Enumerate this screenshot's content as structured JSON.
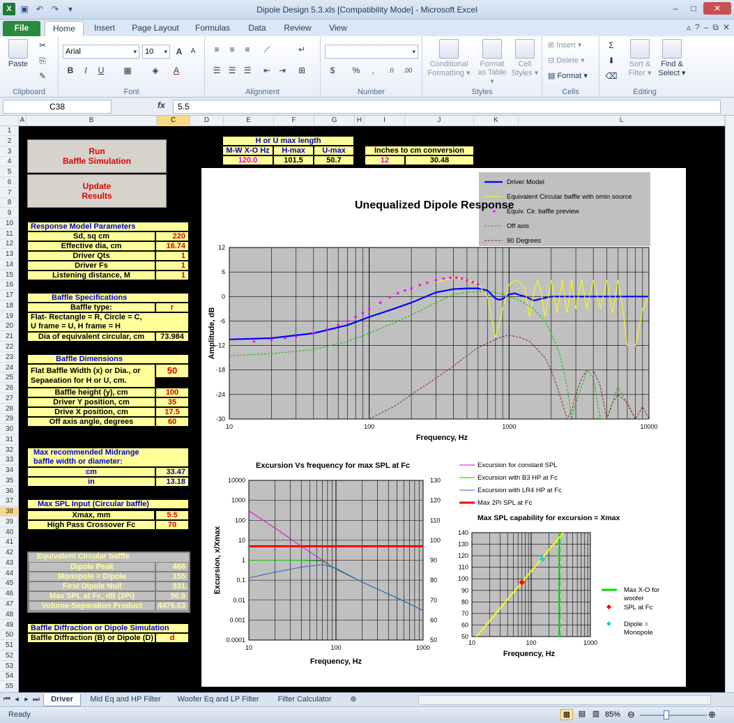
{
  "window": {
    "title": "Dipole Design 5.3.xls  [Compatibility Mode]  -  Microsoft Excel"
  },
  "ribbon_tabs": [
    "File",
    "Home",
    "Insert",
    "Page Layout",
    "Formulas",
    "Data",
    "Review",
    "View"
  ],
  "ribbon": {
    "clipboard": {
      "paste": "Paste",
      "label": "Clipboard"
    },
    "font": {
      "name": "Arial",
      "size": "10",
      "label": "Font"
    },
    "alignment": {
      "label": "Alignment"
    },
    "number": {
      "label": "Number"
    },
    "styles": {
      "conditional": "Conditional",
      "formatting": "Formatting ▾",
      "format": "Format",
      "as_table": "as Table ▾",
      "cell": "Cell",
      "cell_styles": "Styles ▾",
      "label": "Styles"
    },
    "cells": {
      "insert": "Insert ▾",
      "delete": "Delete ▾",
      "format": "Format ▾",
      "label": "Cells"
    },
    "editing": {
      "sort": "Sort &",
      "filter": "Filter ▾",
      "find": "Find &",
      "select": "Select ▾",
      "label": "Editing"
    }
  },
  "formula_bar": {
    "name_box": "C38",
    "fx": "fx",
    "value": "5.5"
  },
  "columns": [
    "A",
    "B",
    "C",
    "D",
    "E",
    "F",
    "G",
    "H",
    "I",
    "J",
    "K",
    "L"
  ],
  "rows": [
    "1",
    "2",
    "3",
    "4",
    "5",
    "6",
    "7",
    "8",
    "9",
    "10",
    "11",
    "12",
    "13",
    "14",
    "15",
    "16",
    "17",
    "18",
    "19",
    "20",
    "21",
    "22",
    "23",
    "24",
    "25",
    "26",
    "27",
    "28",
    "29",
    "30",
    "31",
    "32",
    "33",
    "34",
    "35",
    "36",
    "37",
    "38",
    "39",
    "40",
    "41",
    "42",
    "43",
    "44",
    "45",
    "46",
    "47",
    "48",
    "49",
    "50",
    "51",
    "52",
    "53",
    "54",
    "55"
  ],
  "buttons": {
    "run": [
      "Run",
      "Baffle  Simulation"
    ],
    "update": [
      "Update",
      "Results"
    ]
  },
  "hu_table": {
    "title": "H or U max length",
    "headers": [
      "M-W  X-O Hz",
      "H-max",
      "U-max"
    ],
    "values": [
      "120.0",
      "101.5",
      "50.7"
    ]
  },
  "conv_table": {
    "title": "Inches to  cm conversion",
    "values": [
      "12",
      "30.48"
    ]
  },
  "response_params": {
    "title": "Response Model Parameters",
    "rows": [
      [
        "Sd, sq cm",
        "220"
      ],
      [
        "Effective dia, cm",
        "16.74"
      ],
      [
        "Driver Qts",
        "1"
      ],
      [
        "Driver Fs",
        "1"
      ],
      [
        "Listening distance, M",
        "1"
      ]
    ]
  },
  "baffle_spec": {
    "title": "Baffle Specifications",
    "type_label": "Baffle type:",
    "type_value": "r",
    "desc1": "Flat- Rectangle = R, Circle = C,",
    "desc2": "U frame = U, H frame = H",
    "dia_label": "Dia of equivalent circular, cm",
    "dia_value": "73.984"
  },
  "baffle_dims": {
    "title": "Baffle Dimensions",
    "width_label1": "Flat Baffle Width (x) or Dia., or",
    "width_label2": "Sepaeation for H or U, cm.",
    "width_value": "50",
    "rows": [
      [
        "Baffle height (y), cm",
        "100"
      ],
      [
        "Driver Y position, cm",
        "35"
      ],
      [
        "Drive X position, cm",
        "17.5"
      ],
      [
        "Off axis angle, degrees",
        "60"
      ]
    ]
  },
  "midrange": {
    "title1": "Max recommended Midrange",
    "title2": "baffle width or diameter:",
    "rows": [
      [
        "cm",
        "33.47"
      ],
      [
        "in",
        "13.18"
      ]
    ]
  },
  "maxspl": {
    "title": "Max SPL Input (Circular baffle)",
    "rows": [
      [
        "Xmax, mm",
        "5.5"
      ],
      [
        "High Pass Crossover Fc",
        "70"
      ]
    ]
  },
  "equiv": {
    "title": "Equivalent  Circular  baffle",
    "rows": [
      [
        "Dipole Peak",
        "466"
      ],
      [
        "Monopole = Dipole",
        "155"
      ],
      [
        "First Dipole Null",
        "931"
      ],
      [
        "Max SPL at Fc, dB (2Pi)",
        "96.9"
      ],
      [
        "Volume-Separation Product",
        "4476.03"
      ]
    ]
  },
  "diffraction": {
    "title": "Baffle Diffraction  or Dipole Simulation",
    "label": "Baffle Diffraction (B) or Dipole (D)",
    "value": "d"
  },
  "sheet_tabs": [
    "Driver",
    "Mid Eq and HP Filter",
    "Woofer Eq and LP Filter",
    "Filter Calculator"
  ],
  "status": {
    "ready": "Ready",
    "zoom": "85%"
  },
  "colors": {
    "sheet_bg": "#000000",
    "input_yellow": "#ffff99",
    "plot_gray": "#c0c0c0",
    "accent_red": "#e00000",
    "accent_blue": "#0000cc"
  },
  "chart_data": [
    {
      "type": "line",
      "title": "Unequalized Dipole Response",
      "xlabel": "Frequency, Hz",
      "ylabel": "Amplitude, dB",
      "xscale": "log",
      "xlim": [
        10,
        10000
      ],
      "ylim": [
        -30,
        12
      ],
      "yticks": [
        12,
        6,
        0,
        -6,
        -12,
        -18,
        -24,
        -30
      ],
      "xticks": [
        10,
        100,
        1000,
        10000
      ],
      "grid": true,
      "legend": "top-right",
      "series": [
        {
          "name": "Driver Model",
          "color": "#0000ff",
          "style": "solid-thick",
          "x": [
            10,
            20,
            40,
            70,
            100,
            150,
            200,
            300,
            400,
            500,
            600,
            700,
            800,
            850,
            900,
            1000,
            1100,
            1200,
            1300,
            1400,
            1500,
            2000,
            3000,
            5000,
            10000
          ],
          "y": [
            -10.5,
            -10.2,
            -9,
            -7,
            -5,
            -3,
            -1.5,
            1,
            1.8,
            2,
            2,
            1.5,
            -0.5,
            -0.8,
            -0.6,
            0.5,
            0.8,
            0.3,
            0,
            -0.5,
            -1,
            0,
            0,
            0,
            0
          ]
        },
        {
          "name": "Equivalent Circular baffle with omin source",
          "color": "#ffff00",
          "style": "solid",
          "x": [
            300,
            400,
            500,
            600,
            700,
            800,
            900,
            1000,
            1100,
            1200,
            1300,
            1400,
            1500,
            1600,
            1700,
            1800,
            2000,
            2200,
            2400,
            2600,
            2800,
            3000,
            3300,
            3600,
            4000,
            4500,
            5000,
            5500,
            6000,
            6500,
            7000,
            8000,
            9000,
            10000
          ],
          "y": [
            3.5,
            4.5,
            4.2,
            3,
            0,
            -10,
            -3,
            3,
            4,
            3.5,
            2,
            -5,
            1,
            4,
            1,
            -5,
            4,
            -4,
            4,
            -4,
            4,
            -3,
            4,
            -3,
            4,
            -3,
            4,
            -4,
            4,
            -3,
            -12,
            -12,
            -3,
            0
          ]
        },
        {
          "name": "Equiv. Cir. baffle preview",
          "color": "#ff00ff",
          "style": "dots",
          "x": [
            15,
            20,
            25,
            30,
            40,
            50,
            60,
            70,
            80,
            90,
            100,
            120,
            140,
            160,
            180,
            200,
            230,
            260,
            300,
            340,
            380,
            420,
            460,
            500,
            550,
            600
          ],
          "y": [
            -11,
            -10.6,
            -10.2,
            -9.8,
            -9,
            -8,
            -7,
            -6,
            -5,
            -4,
            -3,
            -1.5,
            -0.2,
            0.8,
            1.5,
            2,
            2.8,
            3.4,
            4,
            4.4,
            4.6,
            4.6,
            4.4,
            4,
            3.5,
            3
          ]
        },
        {
          "name": "Off axis",
          "color": "#00c000",
          "style": "dashed",
          "x": [
            10,
            20,
            40,
            70,
            100,
            150,
            200,
            300,
            400,
            500,
            600,
            700,
            800,
            1000,
            1200,
            1500,
            1800,
            2000,
            2300,
            2600,
            2800,
            3000,
            3300,
            3600,
            4000,
            4500,
            5000,
            6000,
            8000,
            10000
          ],
          "y": [
            -14.5,
            -14,
            -13,
            -11,
            -9,
            -6.5,
            -4.5,
            -1.5,
            0.5,
            1,
            1.2,
            1.2,
            1,
            0,
            -1,
            -3,
            -6,
            -9,
            -14,
            -22,
            -30,
            -26,
            -22,
            -18,
            -20,
            -30,
            -30,
            -22,
            -30,
            -30
          ]
        },
        {
          "name": "90 Degrees",
          "color": "#8b2020",
          "style": "dashed",
          "x": [
            100,
            150,
            200,
            300,
            400,
            500,
            600,
            700,
            800,
            900,
            1000,
            1200,
            1400,
            1600,
            1800,
            2000,
            2200,
            2400,
            2600,
            2800,
            3000,
            3300,
            3600,
            4000,
            4500,
            5000,
            5500,
            6000,
            7000,
            8000,
            9000,
            10000
          ],
          "y": [
            -30,
            -27,
            -24,
            -20,
            -17,
            -14.5,
            -12.5,
            -11.5,
            -10.5,
            -9.8,
            -9.5,
            -10,
            -11,
            -13,
            -15,
            -18,
            -22,
            -26,
            -30,
            -28,
            -24,
            -20,
            -18,
            -18,
            -22,
            -30,
            -26,
            -24,
            -26,
            -30,
            -27,
            -30
          ]
        }
      ]
    },
    {
      "type": "line",
      "title": "Excursion Vs frequency for max SPL  at Fc",
      "xlabel": "Frequency, Hz",
      "ylabel": "Excursion, x/Xmax",
      "xscale": "log",
      "yscale": "log",
      "xlim": [
        10,
        1000
      ],
      "ylim": [
        0.0001,
        10000
      ],
      "y2lim": [
        50,
        130
      ],
      "yticks": [
        "10000",
        "1000",
        "100",
        "10",
        "1",
        "0.1",
        "0.01",
        "0.001",
        "0.0001"
      ],
      "y2ticks": [
        "130",
        "120",
        "110",
        "100",
        "90",
        "80",
        "70",
        "60",
        "50"
      ],
      "xticks": [
        "10",
        "100",
        "1000"
      ],
      "grid": true,
      "legend": "right",
      "series": [
        {
          "name": "Excursion for constant SPL",
          "color": "#e000e0",
          "x": [
            10,
            20,
            40,
            70,
            100,
            200,
            500,
            1000
          ],
          "y": [
            300,
            40,
            5,
            1,
            0.35,
            0.08,
            0.013,
            0.003
          ]
        },
        {
          "name": "Excursion with B3 HP at Fc",
          "color": "#00c000",
          "x": [
            10,
            20,
            40,
            70,
            100,
            200,
            500,
            1000
          ],
          "y": [
            1,
            1,
            1,
            0.9,
            0.35,
            0.08,
            0.013,
            0.003
          ]
        },
        {
          "name": "Excursion with LR4 HP at Fc",
          "color": "#3060d0",
          "x": [
            10,
            20,
            40,
            70,
            100,
            200,
            500,
            1000
          ],
          "y": [
            0.13,
            0.25,
            0.45,
            0.6,
            0.4,
            0.08,
            0.013,
            0.003
          ]
        },
        {
          "name": "Max 2Pi SPL at Fc",
          "color": "#ff0000",
          "x": [
            10,
            1000
          ],
          "y": [
            5,
            5
          ]
        }
      ]
    },
    {
      "type": "line",
      "title": "Max SPL  capability for excursion = Xmax",
      "xscale": "log",
      "xlim": [
        10,
        1000
      ],
      "ylim": [
        50,
        140
      ],
      "yticks": [
        "140",
        "130",
        "120",
        "110",
        "100",
        "90",
        "80",
        "70",
        "60",
        "50"
      ],
      "xticks": [
        "10",
        "100",
        "1000"
      ],
      "xlabel": "Frequency, Hz",
      "grid": true,
      "legend": "right",
      "series": [
        {
          "name": "Max X-O for woofer",
          "color": "#00dd00",
          "x": [
            300,
            300
          ],
          "y": [
            50,
            140
          ]
        },
        {
          "name": "SPL at Fc",
          "color": "#ff0000",
          "x": [
            70
          ],
          "y": [
            96.9
          ]
        },
        {
          "name": "Dipole  =  Monopole",
          "color": "#00dddd",
          "x": [
            155
          ],
          "y": [
            117
          ]
        },
        {
          "color": "#ffff00",
          "x": [
            12,
            350
          ],
          "y": [
            50,
            140
          ]
        }
      ]
    }
  ]
}
